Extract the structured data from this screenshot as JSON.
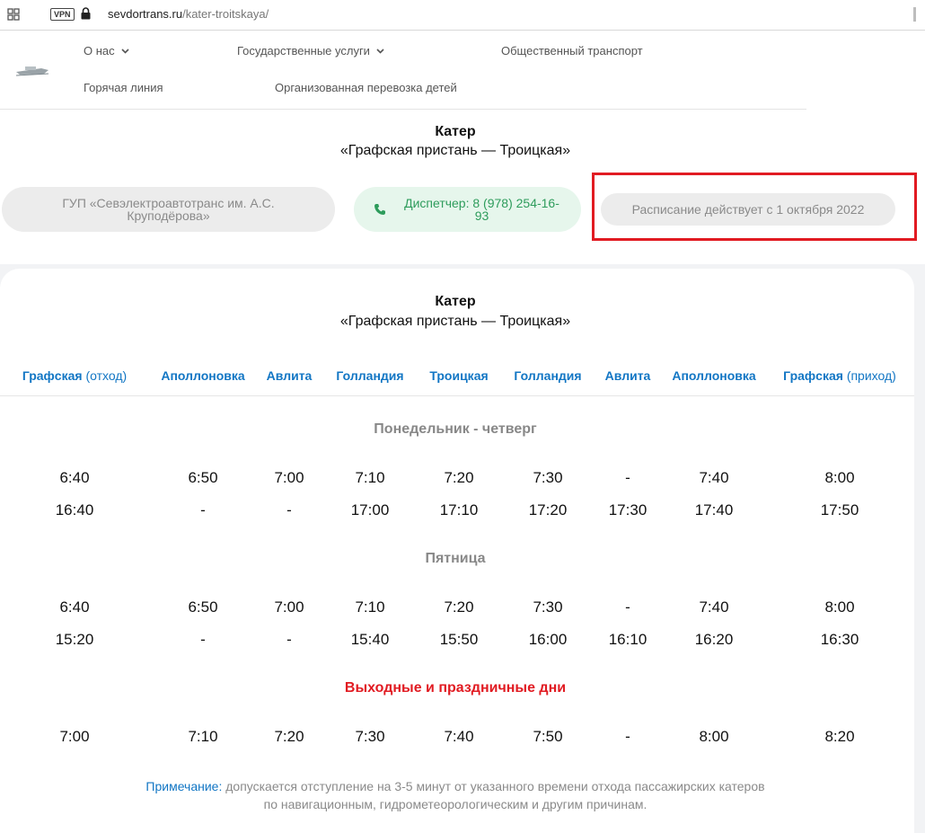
{
  "browser": {
    "vpn_label": "VPN",
    "url_domain": "sevdortrans.ru",
    "url_path": "/kater-troitskaya/"
  },
  "nav": {
    "items": [
      {
        "label": "О нас",
        "has_dropdown": true
      },
      {
        "label": "Государственные услуги",
        "has_dropdown": true
      },
      {
        "label": "Общественный транспорт",
        "has_dropdown": false
      },
      {
        "label": "Горячая линия",
        "has_dropdown": false
      },
      {
        "label": "Организованная перевозка детей",
        "has_dropdown": false
      }
    ]
  },
  "header": {
    "title": "Катер",
    "subtitle": "«Графская пристань — Троицкая»"
  },
  "info": {
    "organization": "ГУП «Севэлектроавтотранс им. А.С. Круподёрова»",
    "dispatcher": "Диспетчер: 8 (978) 254-16-93",
    "schedule_valid": "Расписание действует с 1 октября 2022"
  },
  "table": {
    "title": "Катер",
    "subtitle": "«Графская пристань — Троицкая»",
    "columns": [
      {
        "name": "Графская",
        "extra": "(отход)"
      },
      {
        "name": "Аполлоновка",
        "extra": ""
      },
      {
        "name": "Авлита",
        "extra": ""
      },
      {
        "name": "Голландия",
        "extra": ""
      },
      {
        "name": "Троицкая",
        "extra": ""
      },
      {
        "name": "Голландия",
        "extra": ""
      },
      {
        "name": "Авлита",
        "extra": ""
      },
      {
        "name": "Аполлоновка",
        "extra": ""
      },
      {
        "name": "Графская",
        "extra": "(приход)"
      }
    ],
    "sections": [
      {
        "title": "Понедельник - четверг",
        "highlight": false,
        "rows": [
          [
            "6:40",
            "6:50",
            "7:00",
            "7:10",
            "7:20",
            "7:30",
            "-",
            "7:40",
            "8:00"
          ],
          [
            "16:40",
            "-",
            "-",
            "17:00",
            "17:10",
            "17:20",
            "17:30",
            "17:40",
            "17:50"
          ]
        ]
      },
      {
        "title": "Пятница",
        "highlight": false,
        "rows": [
          [
            "6:40",
            "6:50",
            "7:00",
            "7:10",
            "7:20",
            "7:30",
            "-",
            "7:40",
            "8:00"
          ],
          [
            "15:20",
            "-",
            "-",
            "15:40",
            "15:50",
            "16:00",
            "16:10",
            "16:20",
            "16:30"
          ]
        ]
      },
      {
        "title": "Выходные и праздничные дни",
        "highlight": true,
        "rows": [
          [
            "7:00",
            "7:10",
            "7:20",
            "7:30",
            "7:40",
            "7:50",
            "-",
            "8:00",
            "8:20"
          ]
        ]
      }
    ],
    "note_label": "Примечание:",
    "note_text_line1": "допускается отступление на 3-5 минут от указанного времени отхода пассажирских катеров",
    "note_text_line2": "по навигационным, гидрометеорологическим и другим причинам."
  },
  "colors": {
    "accent": "#1276c4",
    "highlight_red": "#e11b22",
    "dispatcher_green": "#2e9c5c"
  }
}
